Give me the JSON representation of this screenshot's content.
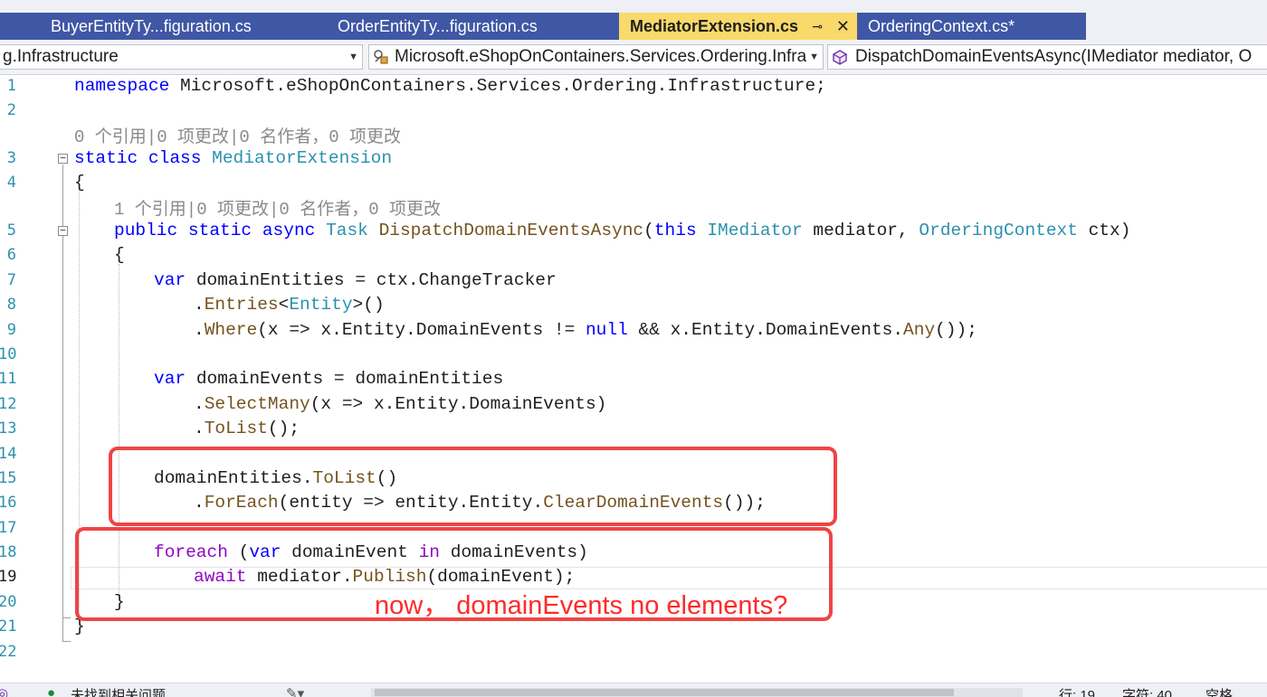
{
  "tabs": [
    {
      "label": "BuyerEntityTy...figuration.cs",
      "active": false
    },
    {
      "label": "OrderEntityTy...figuration.cs",
      "active": false
    },
    {
      "label": "MediatorExtension.cs",
      "active": true
    },
    {
      "label": "OrderingContext.cs*",
      "active": false
    }
  ],
  "tab_icons": {
    "pin": "⊸",
    "close": "✕"
  },
  "navbar": {
    "project": "g.Infrastructure",
    "type_scope": "Microsoft.eShopOnContainers.Services.Ordering.Infra",
    "member": "DispatchDomainEventsAsync(IMediator mediator, O"
  },
  "line_numbers": [
    "1",
    "2",
    "",
    "3",
    "4",
    "",
    "5",
    "6",
    "7",
    "8",
    "9",
    "10",
    "11",
    "12",
    "13",
    "14",
    "15",
    "16",
    "17",
    "18",
    "19",
    "20",
    "21",
    "22"
  ],
  "code": {
    "ns_kw": "namespace",
    "ns_name": " Microsoft.eShopOnContainers.Services.Ordering.Infrastructure;",
    "lens_class": "0 个引用|0 项更改|0 名作者，0 项更改",
    "static_kw": "static",
    "class_kw": "class",
    "class_name": "MediatorExtension",
    "open_brace": "{",
    "close_brace": "}",
    "lens_method": "1 个引用|0 项更改|0 名作者，0 项更改",
    "public_kw": "public",
    "async_kw": "async",
    "task_type": "Task",
    "method_name": "DispatchDomainEventsAsync",
    "this_kw": "this",
    "imediator": "IMediator",
    "mediator_param": "mediator,",
    "ctx_type": "OrderingContext",
    "ctx_param": "ctx)",
    "var_kw": "var",
    "l7_rest": "domainEntities = ctx.ChangeTracker",
    "l8_dot": ".",
    "l8_entries": "Entries",
    "l8_lt": "<",
    "l8_entity": "Entity",
    "l8_gt": ">()",
    "l9_dot": ".",
    "l9_where": "Where",
    "l9_mid": "(x => x.Entity.DomainEvents != ",
    "null_kw": "null",
    "l9_mid2": " && x.Entity.DomainEvents.",
    "l9_any": "Any",
    "l9_end": "());",
    "l11_rest": "domainEvents = domainEntities",
    "l12_selectmany": "SelectMany",
    "l12_rest": "(x => x.Entity.DomainEvents)",
    "l13_tolist": "ToList",
    "l13_rest": "();",
    "l15_a": "domainEntities.",
    "l15_tolist": "ToList",
    "l15_b": "()",
    "l16_foreach": "ForEach",
    "l16_mid": "(entity => entity.Entity.",
    "l16_clear": "ClearDomainEvents",
    "l16_end": "());",
    "foreach_kw": "foreach",
    "l18_open": "(",
    "in_kw": "in",
    "l18_mid": "domainEvent",
    "l18_end": "domainEvents)",
    "await_kw": "await",
    "l19_a": "mediator.",
    "l19_publish": "Publish",
    "l19_b": "(domainEvent);"
  },
  "annotation": "now， domainEvents no elements?",
  "status": {
    "issues": "未找到相关问题",
    "line": "行: 19",
    "char": "字符: 40",
    "space": "空格"
  },
  "colors": {
    "tab_bg": "#3f57a5",
    "tab_active": "#f8d96a",
    "keyword": "#0000ff",
    "type": "#2b91af",
    "control": "#8f08c4",
    "method": "#74531f",
    "annotation_red": "#ef4444"
  }
}
